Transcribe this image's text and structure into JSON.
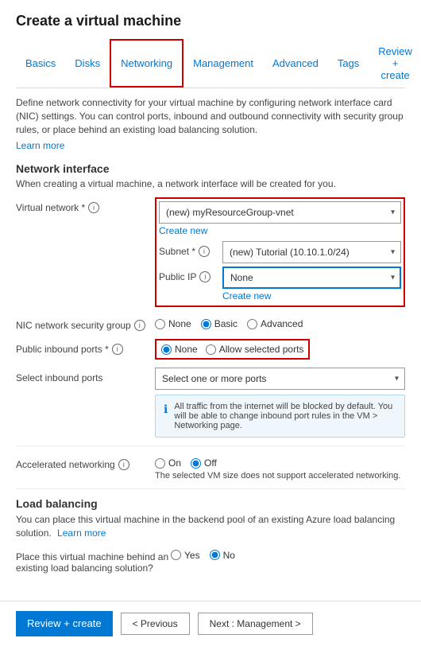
{
  "page": {
    "title": "Create a virtual machine"
  },
  "tabs": [
    {
      "id": "basics",
      "label": "Basics",
      "active": false
    },
    {
      "id": "disks",
      "label": "Disks",
      "active": false
    },
    {
      "id": "networking",
      "label": "Networking",
      "active": true
    },
    {
      "id": "management",
      "label": "Management",
      "active": false
    },
    {
      "id": "advanced",
      "label": "Advanced",
      "active": false
    },
    {
      "id": "tags",
      "label": "Tags",
      "active": false
    },
    {
      "id": "review-create",
      "label": "Review + create",
      "active": false
    }
  ],
  "description": "Define network connectivity for your virtual machine by configuring network interface card (NIC) settings. You can control ports, inbound and outbound connectivity with security group rules, or place behind an existing load balancing solution.",
  "learn_more": "Learn more",
  "network_interface": {
    "title": "Network interface",
    "description": "When creating a virtual machine, a network interface will be created for you.",
    "fields": {
      "virtual_network": {
        "label": "Virtual network *",
        "value": "(new) myResourceGroup-vnet",
        "create_new": "Create new"
      },
      "subnet": {
        "label": "Subnet *",
        "value": "(new) Tutorial (10.10.1.0/24)"
      },
      "public_ip": {
        "label": "Public IP",
        "value": "None",
        "create_new": "Create new"
      },
      "nic_security_group": {
        "label": "NIC network security group",
        "options": [
          "None",
          "Basic",
          "Advanced"
        ],
        "selected": "Basic"
      },
      "public_inbound_ports": {
        "label": "Public inbound ports *",
        "options": [
          "None",
          "Allow selected ports"
        ],
        "selected": "None"
      },
      "select_inbound_ports": {
        "label": "Select inbound ports",
        "placeholder": "Select one or more ports"
      }
    },
    "info_message": "All traffic from the internet will be blocked by default. You will be able to change inbound port rules in the VM > Networking page."
  },
  "accelerated_networking": {
    "label": "Accelerated networking",
    "options": [
      "On",
      "Off"
    ],
    "selected": "Off",
    "note": "The selected VM size does not support accelerated networking."
  },
  "load_balancing": {
    "title": "Load balancing",
    "description": "You can place this virtual machine in the backend pool of an existing Azure load balancing solution.",
    "learn_more": "Learn more",
    "field": {
      "label": "Place this virtual machine behind an existing load balancing solution?",
      "options": [
        "Yes",
        "No"
      ],
      "selected": "No"
    }
  },
  "footer": {
    "review_button": "Review + create",
    "previous_button": "< Previous",
    "next_button": "Next : Management >"
  }
}
